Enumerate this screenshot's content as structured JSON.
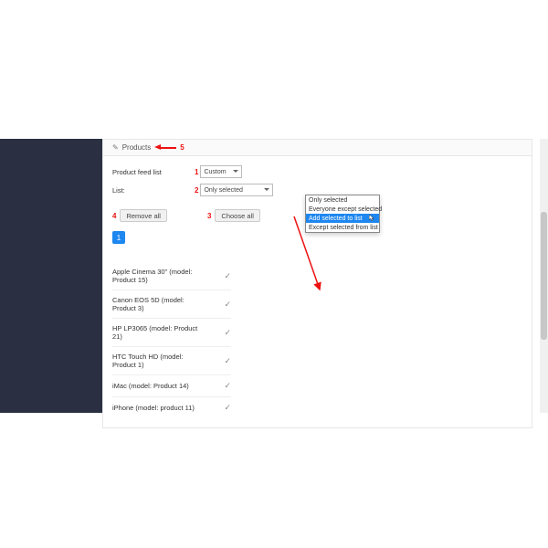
{
  "panel": {
    "title": "Products",
    "title_anno": "5"
  },
  "form": {
    "feed_label": "Product feed list",
    "list_label": "List:",
    "feed_anno": "1",
    "list_anno": "2",
    "feed_select": {
      "selected": "Custom"
    },
    "list_select": {
      "selected": "Only selected",
      "options": [
        "Only selected",
        "Everyone except selected",
        "Add selected to list",
        "Except selected from list"
      ],
      "highlighted_index": 2
    }
  },
  "toolbar": {
    "remove_all_anno": "4",
    "remove_all": "Remove all",
    "choose_all_anno": "3",
    "choose_all": "Choose all"
  },
  "pagination": {
    "current": "1"
  },
  "products": [
    {
      "name": "Apple Cinema 30\" (model: Product 15)"
    },
    {
      "name": "Canon EOS 5D (model: Product 3)"
    },
    {
      "name": "HP LP3065 (model: Product 21)"
    },
    {
      "name": "HTC Touch HD (model: Product 1)"
    },
    {
      "name": "iMac (model: Product 14)"
    },
    {
      "name": "iPhone (model: product 11)"
    }
  ]
}
